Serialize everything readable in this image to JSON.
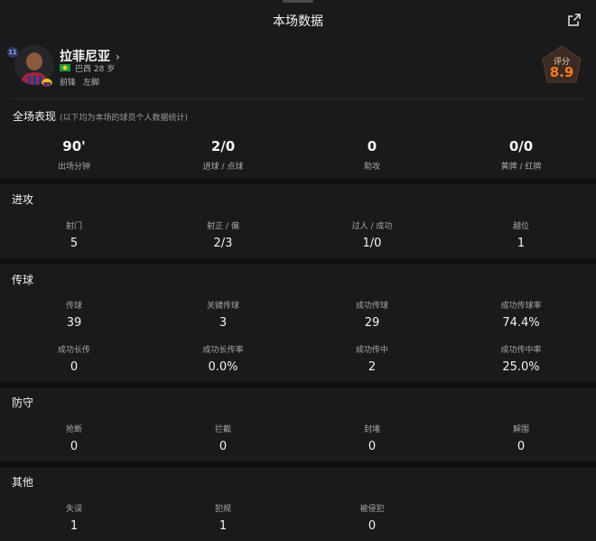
{
  "header": {
    "title": "本场数据",
    "share_icon": "share-icon"
  },
  "player": {
    "shirt_number": "11",
    "name": "拉菲尼亚",
    "chevron": "›",
    "country": "巴西",
    "age": "28 岁",
    "position": "前锋",
    "foot": "左脚",
    "rating_label": "评分",
    "rating_value": "8.9",
    "rating_color": "#ff7a1f"
  },
  "summary": {
    "title": "全场表现",
    "note": "(以下均为本场的球员个人数据统计)",
    "stats": [
      {
        "value": "90'",
        "label": "出场分钟"
      },
      {
        "value": "2/0",
        "label": "进球 / 点球"
      },
      {
        "value": "0",
        "label": "助攻"
      },
      {
        "value": "0/0",
        "label": "黄牌 / 红牌"
      }
    ]
  },
  "sections": {
    "attack": {
      "title": "进攻",
      "stats": [
        {
          "label": "射门",
          "value": "5"
        },
        {
          "label": "射正 / 偏",
          "value": "2/3"
        },
        {
          "label": "过人 / 成功",
          "value": "1/0"
        },
        {
          "label": "越位",
          "value": "1"
        }
      ]
    },
    "passing": {
      "title": "传球",
      "stats": [
        {
          "label": "传球",
          "value": "39"
        },
        {
          "label": "关键传球",
          "value": "3"
        },
        {
          "label": "成功传球",
          "value": "29"
        },
        {
          "label": "成功传球率",
          "value": "74.4%"
        },
        {
          "label": "成功长传",
          "value": "0"
        },
        {
          "label": "成功长传率",
          "value": "0.0%"
        },
        {
          "label": "成功传中",
          "value": "2"
        },
        {
          "label": "成功传中率",
          "value": "25.0%"
        }
      ]
    },
    "defense": {
      "title": "防守",
      "stats": [
        {
          "label": "抢断",
          "value": "0"
        },
        {
          "label": "拦截",
          "value": "0"
        },
        {
          "label": "封堵",
          "value": "0"
        },
        {
          "label": "解围",
          "value": "0"
        }
      ]
    },
    "other": {
      "title": "其他",
      "stats": [
        {
          "label": "失误",
          "value": "1"
        },
        {
          "label": "犯规",
          "value": "1"
        },
        {
          "label": "被侵犯",
          "value": "0"
        }
      ]
    }
  }
}
